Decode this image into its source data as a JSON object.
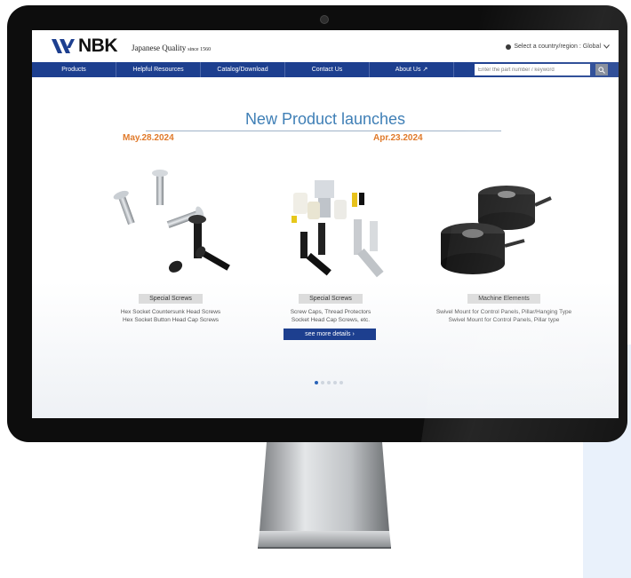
{
  "header": {
    "logo_text": "NBK",
    "tagline": "Japanese Quality",
    "tagline_since": "since 1560",
    "region_text": "Select a country/region : Global"
  },
  "nav": {
    "items": [
      "Products",
      "Helpful Resources",
      "Catalog/Download",
      "Contact Us",
      "About Us"
    ],
    "search_placeholder": "Enter the part number / keyword"
  },
  "hero": {
    "title": "New Product launches",
    "dates": [
      "May.28.2024",
      "Apr.23.2024"
    ],
    "products": [
      {
        "category": "Special Screws",
        "lines": [
          "Hex Socket Countersunk Head Screws",
          "Hex Socket Button Head Cap Screws"
        ]
      },
      {
        "category": "Special Screws",
        "lines": [
          "Screw Caps, Thread Protectors",
          "Socket Head Cap Screws, etc."
        ]
      },
      {
        "category": "Machine Elements",
        "lines": [
          "Swivel Mount for Control Panels, Pillar/Hanging Type",
          "Swivel Mount for Control Panels, Pillar type"
        ]
      }
    ],
    "more_button": "see more details ›"
  },
  "carousel": {
    "total": 5,
    "active": 1
  },
  "colors": {
    "nav_bg": "#1d3f8f",
    "accent_date": "#e07a2b",
    "title_blue": "#3f7fb6"
  }
}
